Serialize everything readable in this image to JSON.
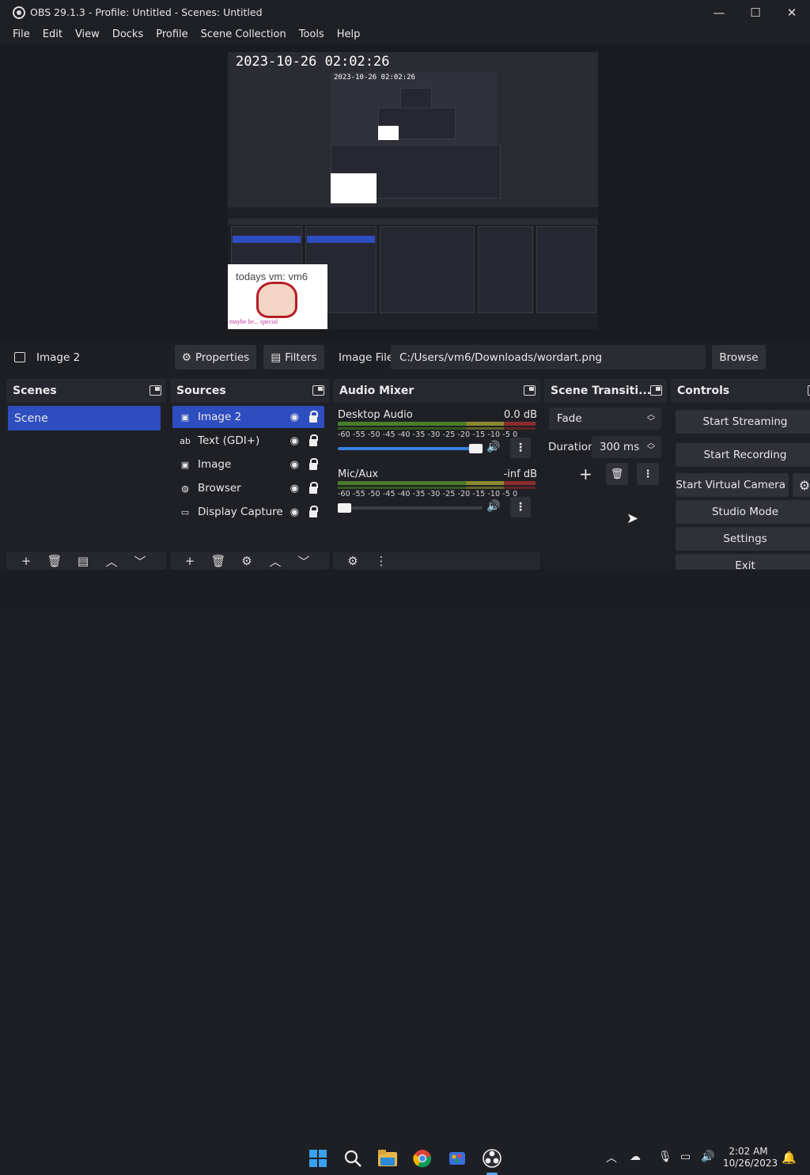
{
  "window": {
    "title": "OBS 29.1.3 - Profile: Untitled - Scenes: Untitled",
    "controls": {
      "minimize": "—",
      "maximize": "☐",
      "close": "✕"
    }
  },
  "menu": [
    "File",
    "Edit",
    "View",
    "Docks",
    "Profile",
    "Scene Collection",
    "Tools",
    "Help"
  ],
  "preview": {
    "timestamp": "2023-10-26 02:02:26",
    "nested_timestamp": "2023-10-26 02:02:26",
    "wordart_text": "todays vm: vm6",
    "wordart_sub": "maybe be... special"
  },
  "context_bar": {
    "source_name": "Image 2",
    "properties_label": "Properties",
    "filters_label": "Filters",
    "image_file_label": "Image File",
    "image_file_value": "C:/Users/vm6/Downloads/wordart.png",
    "browse_label": "Browse"
  },
  "scenes": {
    "title": "Scenes",
    "items": [
      "Scene"
    ]
  },
  "sources": {
    "title": "Sources",
    "items": [
      {
        "name": "Image 2",
        "icon": "image-icon"
      },
      {
        "name": "Text (GDI+)",
        "icon": "text-icon"
      },
      {
        "name": "Image",
        "icon": "image-icon"
      },
      {
        "name": "Browser",
        "icon": "globe-icon"
      },
      {
        "name": "Display Capture",
        "icon": "monitor-icon"
      }
    ]
  },
  "audio_mixer": {
    "title": "Audio Mixer",
    "channels": [
      {
        "name": "Desktop Audio",
        "db": "0.0 dB",
        "volume": 1.0
      },
      {
        "name": "Mic/Aux",
        "db": "-inf dB",
        "volume": 0.0
      }
    ],
    "scale": "-60 -55 -50 -45 -40 -35 -30 -25 -20 -15 -10 -5 0"
  },
  "transitions": {
    "title": "Scene Transiti...",
    "selected": "Fade",
    "duration_label": "Duration",
    "duration_value": "300 ms"
  },
  "controls": {
    "title": "Controls",
    "start_streaming": "Start Streaming",
    "start_recording": "Start Recording",
    "start_virtual_camera": "Start Virtual Camera",
    "studio_mode": "Studio Mode",
    "settings": "Settings",
    "exit": "Exit"
  },
  "taskbar": {
    "time": "2:02 AM",
    "date": "10/26/2023"
  },
  "colors": {
    "accent": "#2e4dbe",
    "dock_bg": "#27282f",
    "panel_bg": "#1f2026"
  }
}
